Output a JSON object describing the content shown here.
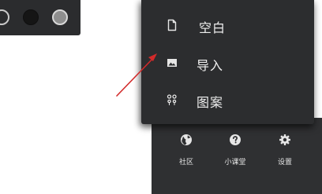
{
  "palette": {
    "swatches": [
      {
        "name": "outline-dark",
        "color": "#2b2c2e"
      },
      {
        "name": "black",
        "color": "#151515"
      },
      {
        "name": "gray",
        "color": "#8e8e8e"
      }
    ]
  },
  "menu": {
    "items": [
      {
        "label": "空白",
        "icon": "document-icon"
      },
      {
        "label": "导入",
        "icon": "image-icon"
      },
      {
        "label": "图案",
        "icon": "pattern-icon"
      }
    ]
  },
  "toolbar": {
    "items": [
      {
        "label": "社区",
        "icon": "globe-icon"
      },
      {
        "label": "小课堂",
        "icon": "help-icon"
      },
      {
        "label": "设置",
        "icon": "gear-icon"
      }
    ]
  },
  "annotation": {
    "arrow_color": "#d22a2a",
    "points_to": "导入"
  },
  "colors": {
    "panel_bg": "#2c2d2f",
    "text": "#eeeeee"
  }
}
